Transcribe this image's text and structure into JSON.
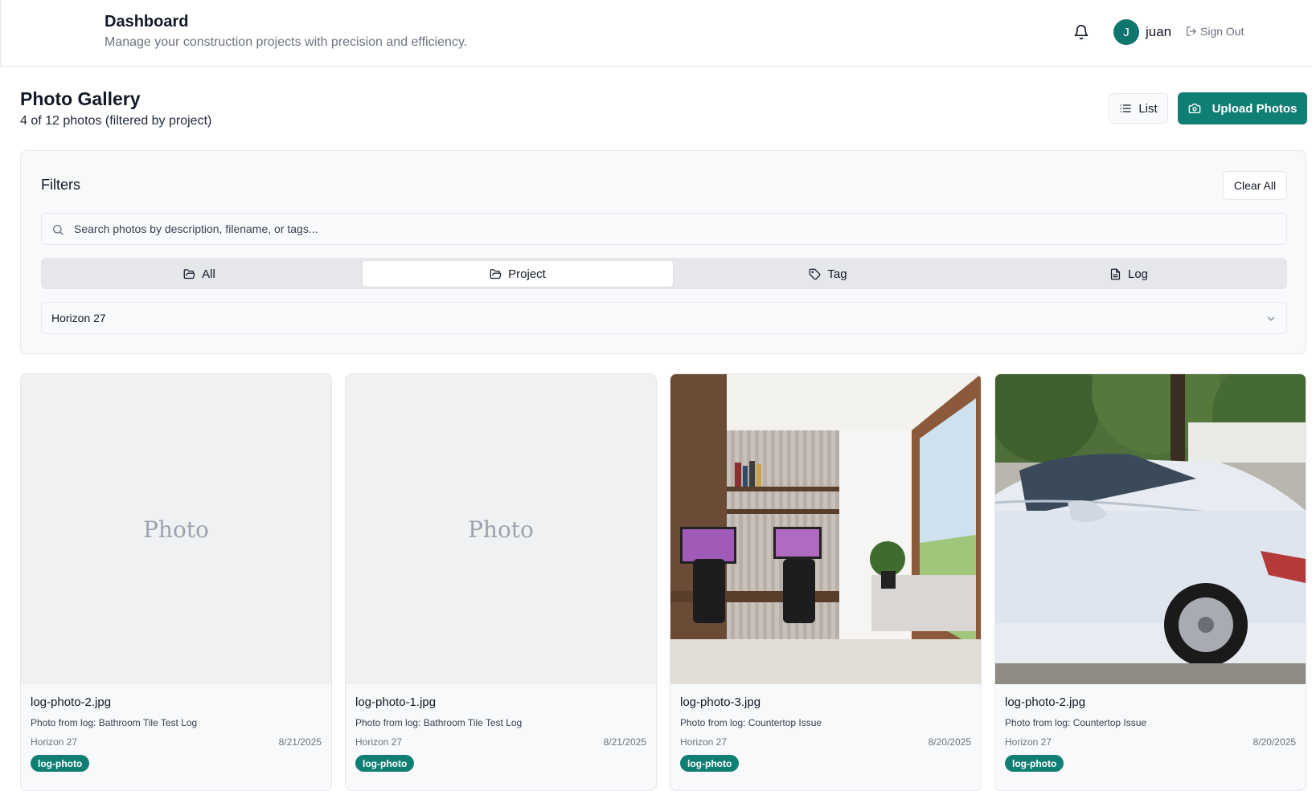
{
  "header": {
    "title": "Dashboard",
    "subtitle": "Manage your construction projects with precision and efficiency.",
    "user": {
      "initial": "J",
      "name": "juan"
    },
    "signout_label": "Sign Out"
  },
  "page": {
    "title": "Photo Gallery",
    "subtitle": "4 of 12 photos (filtered by project)",
    "list_label": "List",
    "upload_label": "Upload Photos"
  },
  "filters": {
    "title": "Filters",
    "clear_label": "Clear All",
    "search_placeholder": "Search photos by description, filename, or tags...",
    "tabs": [
      {
        "label": "All",
        "icon": "folder-icon",
        "active": false
      },
      {
        "label": "Project",
        "icon": "folder-icon",
        "active": true
      },
      {
        "label": "Tag",
        "icon": "tag-icon",
        "active": false
      },
      {
        "label": "Log",
        "icon": "file-text-icon",
        "active": false
      }
    ],
    "selected_project": "Horizon 27"
  },
  "photos": [
    {
      "filename": "log-photo-2.jpg",
      "description": "Photo from log: Bathroom Tile Test Log",
      "project": "Horizon 27",
      "date": "8/21/2025",
      "tag": "log-photo",
      "placeholder": "Photo"
    },
    {
      "filename": "log-photo-1.jpg",
      "description": "Photo from log: Bathroom Tile Test Log",
      "project": "Horizon 27",
      "date": "8/21/2025",
      "tag": "log-photo",
      "placeholder": "Photo"
    },
    {
      "filename": "log-photo-3.jpg",
      "description": "Photo from log: Countertop Issue",
      "project": "Horizon 27",
      "date": "8/20/2025",
      "tag": "log-photo"
    },
    {
      "filename": "log-photo-2.jpg",
      "description": "Photo from log: Countertop Issue",
      "project": "Horizon 27",
      "date": "8/20/2025",
      "tag": "log-photo"
    }
  ],
  "colors": {
    "accent": "#0f7f74",
    "border": "#e5e7eb",
    "panel": "#f8f9fa"
  }
}
